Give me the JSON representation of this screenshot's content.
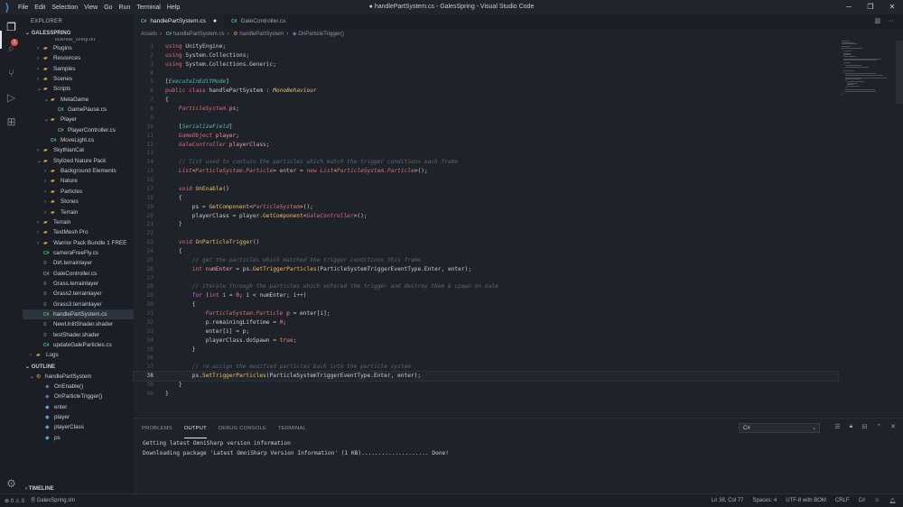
{
  "window": {
    "title": "● handlePartSystem.cs - GalesSpring - Visual Studio Code",
    "menu": [
      "File",
      "Edit",
      "Selection",
      "View",
      "Go",
      "Run",
      "Terminal",
      "Help"
    ]
  },
  "activity_badge": "1",
  "sidebar": {
    "title": "EXPLORER",
    "workspace": "GALESSPRING",
    "partial_item": "license_unity.txt",
    "tree": [
      {
        "label": "Plugins",
        "type": "folder",
        "depth": 1,
        "open": false
      },
      {
        "label": "Resources",
        "type": "folder",
        "depth": 1,
        "open": false
      },
      {
        "label": "Samples",
        "type": "folder",
        "depth": 1,
        "open": false
      },
      {
        "label": "Scenes",
        "type": "folder",
        "depth": 1,
        "open": false
      },
      {
        "label": "Scripts",
        "type": "folder",
        "depth": 1,
        "open": true
      },
      {
        "label": "MetaGame",
        "type": "folder",
        "depth": 2,
        "open": true
      },
      {
        "label": "GamePause.cs",
        "type": "cs",
        "depth": 3
      },
      {
        "label": "Player",
        "type": "folder",
        "depth": 2,
        "open": true
      },
      {
        "label": "PlayerController.cs",
        "type": "cs",
        "depth": 3
      },
      {
        "label": "MoveLight.cs",
        "type": "cs",
        "depth": 2
      },
      {
        "label": "SkythianCat",
        "type": "folder",
        "depth": 1,
        "open": false
      },
      {
        "label": "Stylized Nature Pack",
        "type": "folder",
        "depth": 1,
        "open": true
      },
      {
        "label": "Background Elements",
        "type": "folder",
        "depth": 2,
        "open": false
      },
      {
        "label": "Nature",
        "type": "folder",
        "depth": 2,
        "open": false
      },
      {
        "label": "Particles",
        "type": "folder",
        "depth": 2,
        "open": false
      },
      {
        "label": "Stones",
        "type": "folder",
        "depth": 2,
        "open": false
      },
      {
        "label": "Terrain",
        "type": "folder",
        "depth": 2,
        "open": false
      },
      {
        "label": "Terrain",
        "type": "folder",
        "depth": 1,
        "open": false
      },
      {
        "label": "TextMesh Pro",
        "type": "folder",
        "depth": 1,
        "open": false
      },
      {
        "label": "Warrior Pack Bundle 1 FREE",
        "type": "folder",
        "depth": 1,
        "open": false
      },
      {
        "label": "cameraFreeFly.cs",
        "type": "cs",
        "depth": 1
      },
      {
        "label": "Dirt.terrainlayer",
        "type": "file",
        "depth": 1
      },
      {
        "label": "GaleController.cs",
        "type": "cs",
        "depth": 1
      },
      {
        "label": "Grass.terrainlayer",
        "type": "file",
        "depth": 1
      },
      {
        "label": "Grass2.terrainlayer",
        "type": "file",
        "depth": 1
      },
      {
        "label": "Grass3.terrainlayer",
        "type": "file",
        "depth": 1
      },
      {
        "label": "handlePartSystem.cs",
        "type": "cs",
        "depth": 1,
        "selected": true
      },
      {
        "label": "NewUnlitShader.shader",
        "type": "file",
        "depth": 1
      },
      {
        "label": "testShader.shader",
        "type": "file",
        "depth": 1
      },
      {
        "label": "updateGaleParticles.cs",
        "type": "cs",
        "depth": 1
      },
      {
        "label": "Logs",
        "type": "folder",
        "depth": 0,
        "open": false
      }
    ],
    "outline_title": "OUTLINE",
    "outline": [
      {
        "label": "handlePartSystem",
        "kind": "class",
        "depth": 0
      },
      {
        "label": "OnEnable()",
        "kind": "method",
        "depth": 1
      },
      {
        "label": "OnParticleTrigger()",
        "kind": "method",
        "depth": 1
      },
      {
        "label": "enter",
        "kind": "field",
        "depth": 1
      },
      {
        "label": "player",
        "kind": "field",
        "depth": 1
      },
      {
        "label": "playerClass",
        "kind": "field",
        "depth": 1
      },
      {
        "label": "ps",
        "kind": "field",
        "depth": 1
      }
    ],
    "timeline_title": "TIMELINE"
  },
  "tabs": [
    {
      "label": "handlePartSystem.cs",
      "active": true,
      "modified": true
    },
    {
      "label": "GaleController.cs",
      "active": false,
      "modified": false
    }
  ],
  "breadcrumb": [
    "Assets",
    "handlePartSystem.cs",
    "handlePartSystem",
    "OnParticleTrigger()"
  ],
  "code": {
    "current_line": 38,
    "lines": [
      [
        [
          "kw",
          "using"
        ],
        [
          "pl",
          " UnityEngine;"
        ]
      ],
      [
        [
          "kw",
          "using"
        ],
        [
          "pl",
          " System.Collections;"
        ]
      ],
      [
        [
          "kw",
          "using"
        ],
        [
          "pl",
          " System.Collections.Generic;"
        ]
      ],
      [],
      [
        [
          "pl",
          "["
        ],
        [
          "attr",
          "ExecuteInEditMode"
        ],
        [
          "pl",
          "]"
        ]
      ],
      [
        [
          "kw",
          "public"
        ],
        [
          "pl",
          " "
        ],
        [
          "kw",
          "class"
        ],
        [
          "pl",
          " handlePartSystem : "
        ],
        [
          "ty",
          "MonoBehaviour"
        ]
      ],
      [
        [
          "pl",
          "{"
        ]
      ],
      [
        [
          "pl",
          "    "
        ],
        [
          "ty2",
          "ParticleSystem"
        ],
        [
          "pl",
          " "
        ],
        [
          "var",
          "ps"
        ],
        [
          "pl",
          ";"
        ]
      ],
      [],
      [
        [
          "pl",
          "    ["
        ],
        [
          "attr",
          "SerializeField"
        ],
        [
          "pl",
          "]"
        ]
      ],
      [
        [
          "pl",
          "    "
        ],
        [
          "ty2",
          "GameObject"
        ],
        [
          "pl",
          " "
        ],
        [
          "var",
          "player"
        ],
        [
          "pl",
          ";"
        ]
      ],
      [
        [
          "pl",
          "    "
        ],
        [
          "ty2",
          "GaleController"
        ],
        [
          "pl",
          " "
        ],
        [
          "var",
          "playerClass"
        ],
        [
          "pl",
          ";"
        ]
      ],
      [],
      [
        [
          "pl",
          "    "
        ],
        [
          "cm",
          "// list used to contain the particles which match the trigger conditions each frame"
        ]
      ],
      [
        [
          "pl",
          "    "
        ],
        [
          "ty2",
          "List"
        ],
        [
          "pl",
          "<"
        ],
        [
          "ty2",
          "ParticleSystem.Particle"
        ],
        [
          "pl",
          "> "
        ],
        [
          "var",
          "enter"
        ],
        [
          "pl",
          " = "
        ],
        [
          "kw",
          "new"
        ],
        [
          "pl",
          " "
        ],
        [
          "ty2",
          "List"
        ],
        [
          "pl",
          "<"
        ],
        [
          "ty2",
          "ParticleSystem.Particle"
        ],
        [
          "pl",
          ">();"
        ]
      ],
      [],
      [
        [
          "pl",
          "    "
        ],
        [
          "kw",
          "void"
        ],
        [
          "pl",
          " "
        ],
        [
          "fn",
          "OnEnable"
        ],
        [
          "pl",
          "()"
        ]
      ],
      [
        [
          "pl",
          "    {"
        ]
      ],
      [
        [
          "pl",
          "        ps = "
        ],
        [
          "fn",
          "GetComponent"
        ],
        [
          "pl",
          "<"
        ],
        [
          "ty2",
          "ParticleSystem"
        ],
        [
          "pl",
          ">();"
        ]
      ],
      [
        [
          "pl",
          "        playerClass = player."
        ],
        [
          "fn",
          "GetComponent"
        ],
        [
          "pl",
          "<"
        ],
        [
          "ty2",
          "GaleController"
        ],
        [
          "pl",
          ">();"
        ]
      ],
      [
        [
          "pl",
          "    }"
        ]
      ],
      [],
      [
        [
          "pl",
          "    "
        ],
        [
          "kw",
          "void"
        ],
        [
          "pl",
          " "
        ],
        [
          "fn",
          "OnParticleTrigger"
        ],
        [
          "pl",
          "()"
        ]
      ],
      [
        [
          "pl",
          "    {"
        ]
      ],
      [
        [
          "pl",
          "        "
        ],
        [
          "cm",
          "// get the particles which matched the trigger conditions this frame"
        ]
      ],
      [
        [
          "pl",
          "        "
        ],
        [
          "kw",
          "int"
        ],
        [
          "pl",
          " "
        ],
        [
          "var",
          "numEnter"
        ],
        [
          "pl",
          " = ps."
        ],
        [
          "fn",
          "GetTriggerParticles"
        ],
        [
          "pl",
          "(ParticleSystemTriggerEventType.Enter, enter);"
        ]
      ],
      [],
      [
        [
          "pl",
          "        "
        ],
        [
          "cm",
          "// iterate through the particles which entered the trigger and destroy them & spawn on Gale"
        ]
      ],
      [
        [
          "pl",
          "        "
        ],
        [
          "kw2",
          "for"
        ],
        [
          "pl",
          " ("
        ],
        [
          "kw",
          "int"
        ],
        [
          "pl",
          " i = "
        ],
        [
          "num",
          "0"
        ],
        [
          "pl",
          "; i < numEnter; i++)"
        ]
      ],
      [
        [
          "pl",
          "        {"
        ]
      ],
      [
        [
          "pl",
          "            "
        ],
        [
          "ty2",
          "ParticleSystem.Particle"
        ],
        [
          "pl",
          " "
        ],
        [
          "var",
          "p"
        ],
        [
          "pl",
          " = enter[i];"
        ]
      ],
      [
        [
          "pl",
          "            p.remainingLifetime = "
        ],
        [
          "num",
          "0"
        ],
        [
          "pl",
          ";"
        ]
      ],
      [
        [
          "pl",
          "            enter[i] = p;"
        ]
      ],
      [
        [
          "pl",
          "            playerClass.doSpawn = "
        ],
        [
          "num",
          "true"
        ],
        [
          "pl",
          ";"
        ]
      ],
      [
        [
          "pl",
          "        }"
        ]
      ],
      [],
      [
        [
          "pl",
          "        "
        ],
        [
          "cm",
          "// re-assign the modified particles back into the particle system"
        ]
      ],
      [
        [
          "pl",
          "        ps."
        ],
        [
          "fn",
          "SetTriggerParticles"
        ],
        [
          "pl",
          "(ParticleSystemTriggerEventType.Enter, enter);"
        ]
      ],
      [
        [
          "pl",
          "    }"
        ]
      ],
      [
        [
          "pl",
          "}"
        ]
      ]
    ]
  },
  "panel": {
    "tabs": [
      "PROBLEMS",
      "OUTPUT",
      "DEBUG CONSOLE",
      "TERMINAL"
    ],
    "active_tab": "OUTPUT",
    "channel": "C#",
    "output": [
      "Getting latest OmniSharp version information",
      "Downloading package 'Latest OmniSharp Version Information' (1 KB).................... Done!"
    ]
  },
  "status": {
    "errors": "0",
    "warnings": "0",
    "project": "GalesSpring.sln",
    "position": "Ln 38, Col 77",
    "spaces": "Spaces: 4",
    "encoding": "UTF-8 with BOM",
    "eol": "CRLF",
    "language": "C#"
  }
}
